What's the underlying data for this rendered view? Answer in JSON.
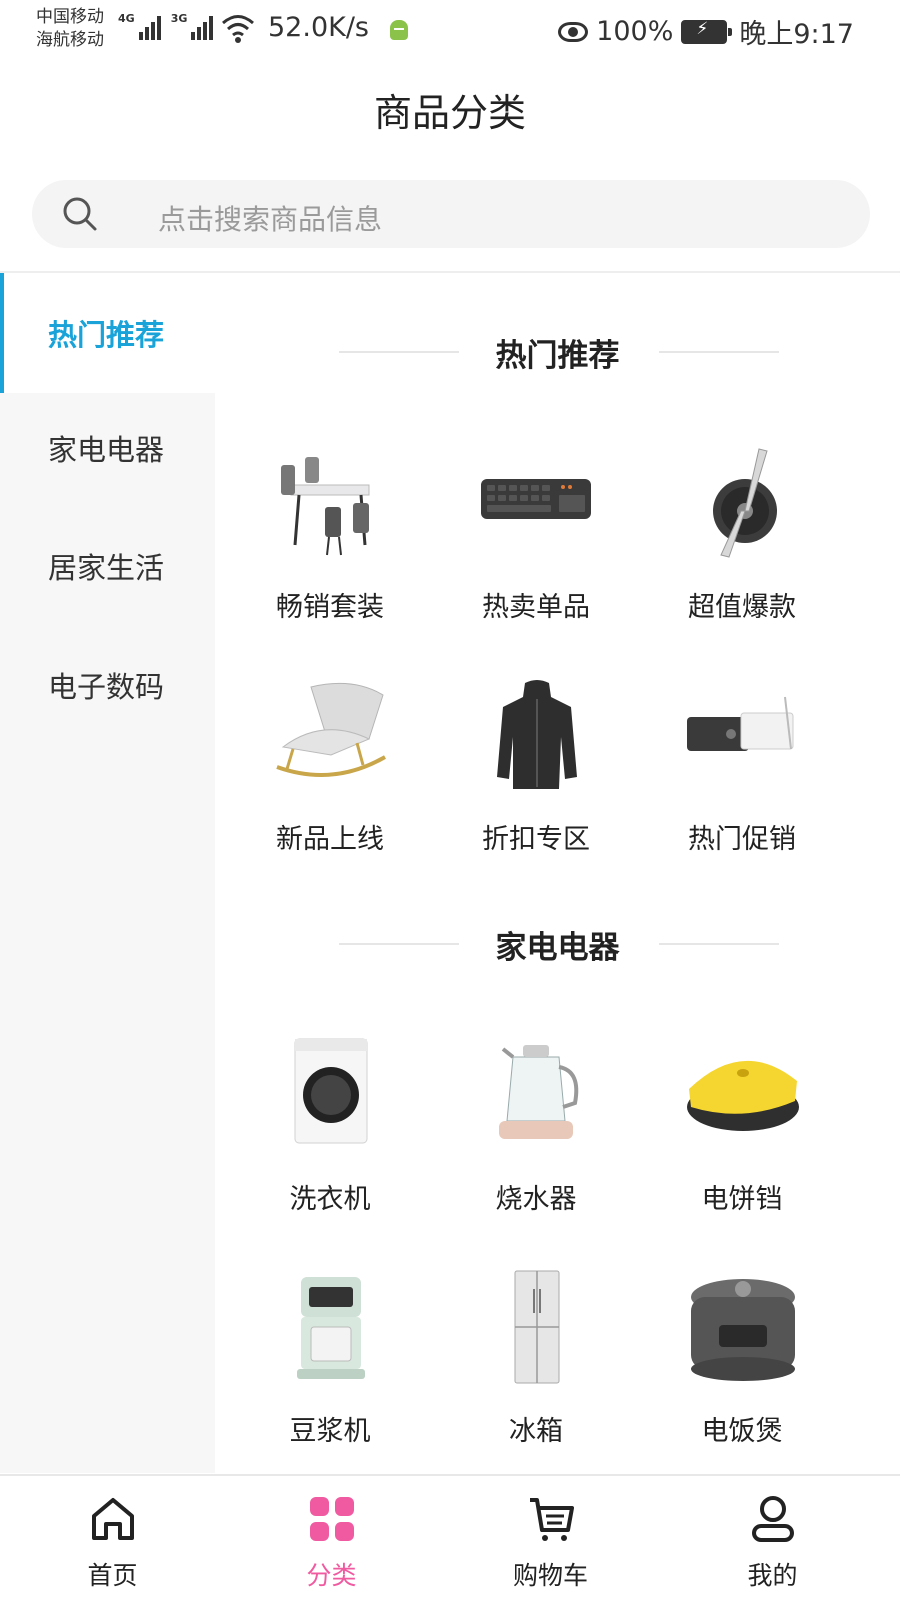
{
  "status_bar": {
    "carrier_1": "中国移动",
    "carrier_2": "海航移动",
    "net_1": "4G",
    "net_2": "3G",
    "speed": "52.0K/s",
    "battery": "100%",
    "time": "晚上9:17"
  },
  "header": {
    "title": "商品分类"
  },
  "search": {
    "placeholder": "点击搜索商品信息"
  },
  "sidebar": {
    "items": [
      {
        "label": "热门推荐",
        "active": true
      },
      {
        "label": "家电电器",
        "active": false
      },
      {
        "label": "居家生活",
        "active": false
      },
      {
        "label": "电子数码",
        "active": false
      }
    ]
  },
  "sections": [
    {
      "title": "热门推荐",
      "items": [
        {
          "label": "畅销套装",
          "icon": "dining-table-set-icon"
        },
        {
          "label": "热卖单品",
          "icon": "keyboard-icon"
        },
        {
          "label": "超值爆款",
          "icon": "car-air-freshener-icon"
        },
        {
          "label": "新品上线",
          "icon": "rocking-chair-icon"
        },
        {
          "label": "折扣专区",
          "icon": "jacket-icon"
        },
        {
          "label": "热门促销",
          "icon": "projector-icon"
        }
      ]
    },
    {
      "title": "家电电器",
      "items": [
        {
          "label": "洗衣机",
          "icon": "washing-machine-icon"
        },
        {
          "label": "烧水器",
          "icon": "kettle-icon"
        },
        {
          "label": "电饼铛",
          "icon": "electric-pan-icon"
        },
        {
          "label": "豆浆机",
          "icon": "soymilk-maker-icon"
        },
        {
          "label": "冰箱",
          "icon": "refrigerator-icon"
        },
        {
          "label": "电饭煲",
          "icon": "rice-cooker-icon"
        }
      ]
    }
  ],
  "tab_bar": {
    "tabs": [
      {
        "label": "首页",
        "icon": "home-icon",
        "active": false
      },
      {
        "label": "分类",
        "icon": "category-icon",
        "active": true
      },
      {
        "label": "购物车",
        "icon": "cart-icon",
        "active": false
      },
      {
        "label": "我的",
        "icon": "user-icon",
        "active": false
      }
    ]
  },
  "colors": {
    "accent": "#1aa3d9",
    "tab_active": "#f05aa0",
    "sidebar_bg": "#f7f7f7"
  }
}
